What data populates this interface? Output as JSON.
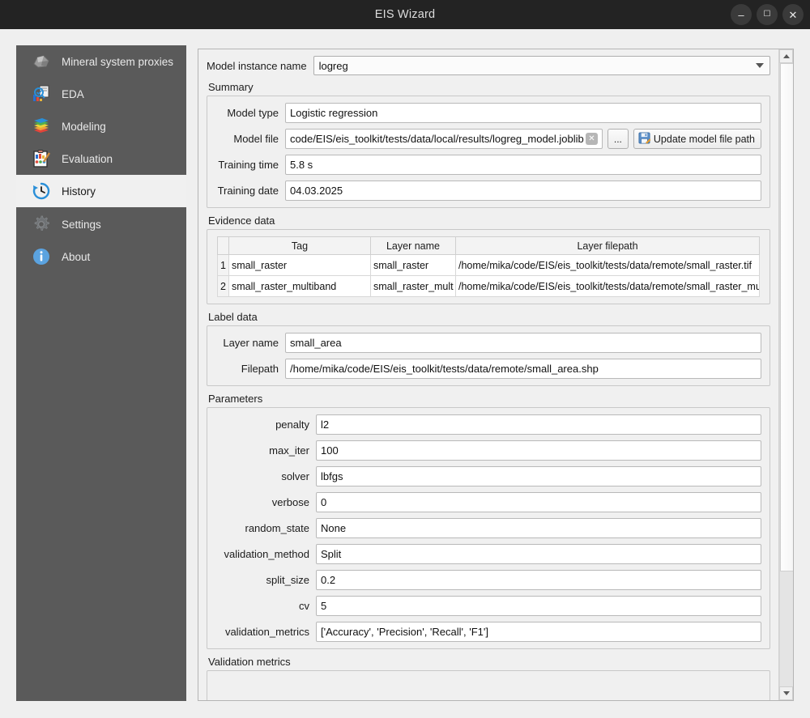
{
  "window": {
    "title": "EIS Wizard",
    "controls": [
      {
        "name": "minimize",
        "glyph": "–"
      },
      {
        "name": "maximize",
        "glyph": "☐"
      },
      {
        "name": "close",
        "glyph": "✕"
      }
    ]
  },
  "sidebar": {
    "items": [
      {
        "label": "Mineral system proxies",
        "icon": "rock-icon",
        "selected": false
      },
      {
        "label": "EDA",
        "icon": "chart-magnifier-icon",
        "selected": false
      },
      {
        "label": "Modeling",
        "icon": "layers-icon",
        "selected": false
      },
      {
        "label": "Evaluation",
        "icon": "clipboard-chart-icon",
        "selected": false
      },
      {
        "label": "History",
        "icon": "clock-history-icon",
        "selected": true
      },
      {
        "label": "Settings",
        "icon": "gear-icon",
        "selected": false
      },
      {
        "label": "About",
        "icon": "info-icon",
        "selected": false
      }
    ]
  },
  "main": {
    "model_instance": {
      "label": "Model instance name",
      "value": "logreg"
    },
    "summary": {
      "title": "Summary",
      "fields": [
        {
          "label": "Model type",
          "value": "Logistic regression"
        },
        {
          "label": "Model file",
          "value": "code/EIS/eis_toolkit/tests/data/local/results/logreg_model.joblib"
        },
        {
          "label": "Training time",
          "value": "5.8 s"
        },
        {
          "label": "Training date",
          "value": "04.03.2025"
        }
      ],
      "browse_button": "...",
      "update_button": "Update model file path",
      "clear_glyph": "✕"
    },
    "evidence_data": {
      "title": "Evidence data",
      "columns": [
        "Tag",
        "Layer name",
        "Layer filepath"
      ],
      "rows": [
        {
          "num": "1",
          "tag": "small_raster",
          "layer_name": "small_raster",
          "layer_filepath": "/home/mika/code/EIS/eis_toolkit/tests/data/remote/small_raster.tif"
        },
        {
          "num": "2",
          "tag": "small_raster_multiband",
          "layer_name": "small_raster_mult",
          "layer_filepath": "/home/mika/code/EIS/eis_toolkit/tests/data/remote/small_raster_multib"
        }
      ]
    },
    "label_data": {
      "title": "Label data",
      "fields": [
        {
          "label": "Layer name",
          "value": "small_area"
        },
        {
          "label": "Filepath",
          "value": "/home/mika/code/EIS/eis_toolkit/tests/data/remote/small_area.shp"
        }
      ]
    },
    "parameters": {
      "title": "Parameters",
      "fields": [
        {
          "label": "penalty",
          "value": "l2"
        },
        {
          "label": "max_iter",
          "value": "100"
        },
        {
          "label": "solver",
          "value": "lbfgs"
        },
        {
          "label": "verbose",
          "value": "0"
        },
        {
          "label": "random_state",
          "value": "None"
        },
        {
          "label": "validation_method",
          "value": "Split"
        },
        {
          "label": "split_size",
          "value": "0.2"
        },
        {
          "label": "cv",
          "value": "5"
        },
        {
          "label": "validation_metrics",
          "value": "['Accuracy', 'Precision', 'Recall', 'F1']"
        }
      ]
    },
    "validation_metrics": {
      "title": "Validation metrics"
    }
  },
  "colors": {
    "titlebar": "#232323",
    "sidebar": "#5a5a5a",
    "selected_item": "#f0f0f0",
    "panel": "#f0f0f0",
    "accent": "#2a8fd8"
  }
}
